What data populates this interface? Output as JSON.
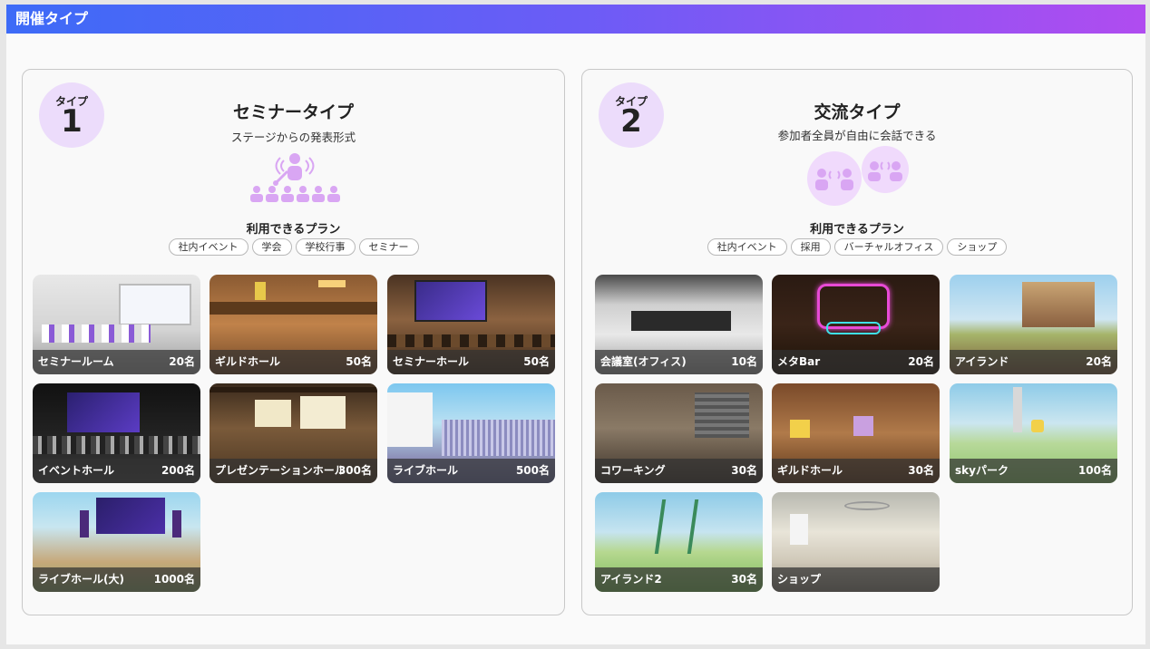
{
  "header": {
    "title": "開催タイプ"
  },
  "panels": [
    {
      "badge_word": "タイプ",
      "badge_num": "1",
      "title": "セミナータイプ",
      "subtitle": "ステージからの発表形式",
      "plan_label": "利用できるプラン",
      "tags": [
        "社内イベント",
        "学会",
        "学校行事",
        "セミナー"
      ],
      "cards": [
        {
          "name": "セミナールーム",
          "cap": "20名"
        },
        {
          "name": "ギルドホール",
          "cap": "50名"
        },
        {
          "name": "セミナーホール",
          "cap": "50名"
        },
        {
          "name": "イベントホール",
          "cap": "200名"
        },
        {
          "name": "プレゼンテーションホール",
          "cap": "300名"
        },
        {
          "name": "ライブホール",
          "cap": "500名"
        },
        {
          "name": "ライブホール(大)",
          "cap": "1000名"
        }
      ]
    },
    {
      "badge_word": "タイプ",
      "badge_num": "2",
      "title": "交流タイプ",
      "subtitle": "参加者全員が自由に会話できる",
      "plan_label": "利用できるプラン",
      "tags": [
        "社内イベント",
        "採用",
        "バーチャルオフィス",
        "ショップ"
      ],
      "cards": [
        {
          "name": "会議室(オフィス)",
          "cap": "10名"
        },
        {
          "name": "メタBar",
          "cap": "20名"
        },
        {
          "name": "アイランド",
          "cap": "20名"
        },
        {
          "name": "コワーキング",
          "cap": "30名"
        },
        {
          "name": "ギルドホール",
          "cap": "30名"
        },
        {
          "name": "skyパーク",
          "cap": "100名"
        },
        {
          "name": "アイランド2",
          "cap": "30名"
        },
        {
          "name": "ショップ",
          "cap": ""
        }
      ]
    }
  ],
  "colors": {
    "accent_purple": "#d6a3f5",
    "badge_bg": "#ecdcfb",
    "header_start": "#3d6bf7",
    "header_end": "#b04cf0"
  }
}
